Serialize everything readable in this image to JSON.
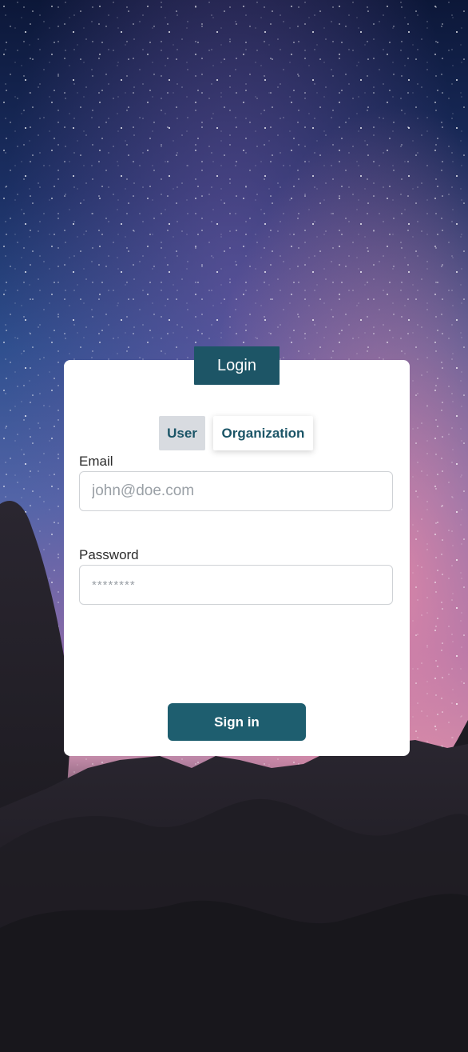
{
  "login_tab": {
    "label": "Login"
  },
  "toggle": {
    "user_label": "User",
    "organization_label": "Organization",
    "selected": "User"
  },
  "email": {
    "label": "Email",
    "placeholder": "john@doe.com",
    "value": ""
  },
  "password": {
    "label": "Password",
    "placeholder": "********",
    "value": ""
  },
  "signin": {
    "label": "Sign in"
  },
  "colors": {
    "accent": "#1d5566",
    "button": "#1e5e6f",
    "toggle_selected_bg": "#d8dbe0",
    "card_bg": "#ffffff"
  }
}
